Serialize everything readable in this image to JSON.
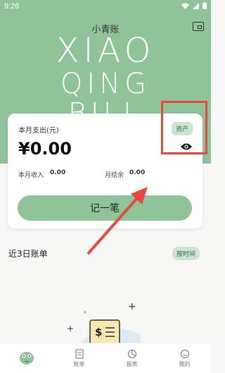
{
  "status_bar": {
    "time": "9:26"
  },
  "app": {
    "title": "小青账",
    "bg_line1": "XIAO",
    "bg_line2": "QING",
    "bg_line3": "BILL"
  },
  "summary": {
    "expense_label": "本月支出(元)",
    "expense_amount": "¥0.00",
    "asset_button": "资产",
    "income_label": "本月收入",
    "income_value": "0.00",
    "balance_label": "月结余",
    "balance_value": "0.00",
    "record_button": "记一笔"
  },
  "recent": {
    "title": "近3日账单",
    "sort_button": "按时间"
  },
  "tabs": [
    {
      "label": "",
      "icon": "home-logo-icon",
      "active": true
    },
    {
      "label": "账单",
      "icon": "bill-icon"
    },
    {
      "label": "报表",
      "icon": "chart-icon"
    },
    {
      "label": "我的",
      "icon": "profile-icon"
    }
  ],
  "colors": {
    "accent": "#8fc49a",
    "annotation": "#e8483f"
  }
}
